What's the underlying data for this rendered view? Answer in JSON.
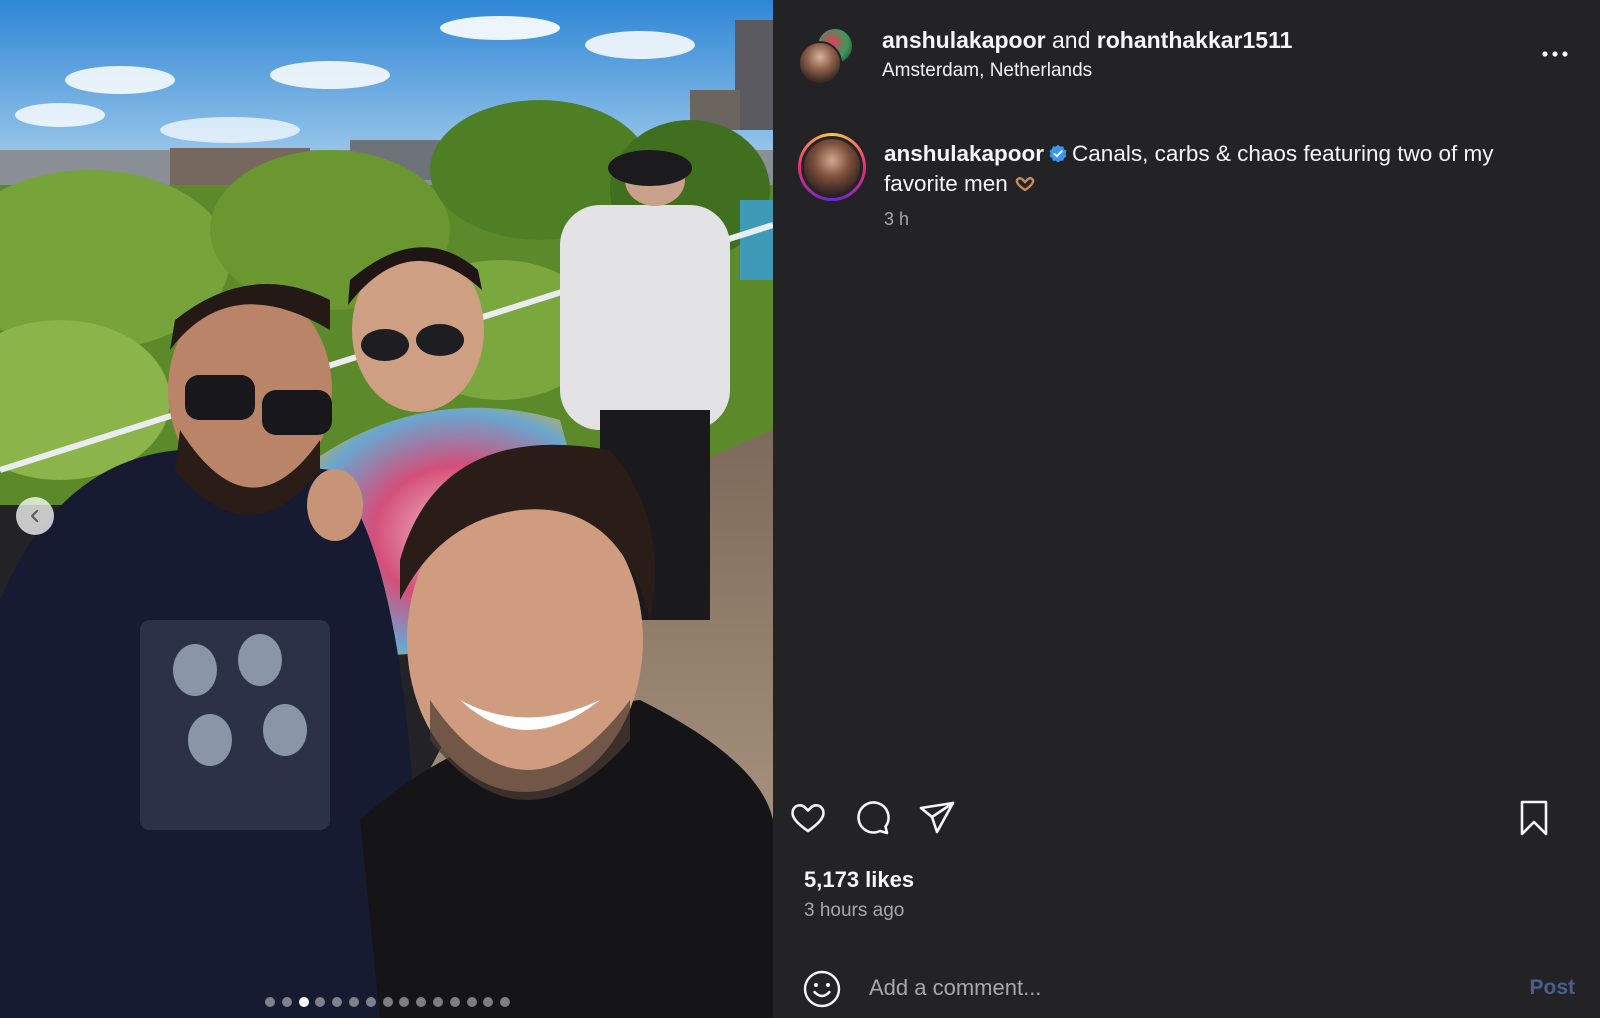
{
  "post": {
    "owner": "anshulakapoor",
    "and_text": "and",
    "coauthor": "rohanthakkar1511",
    "location": "Amsterdam, Netherlands"
  },
  "caption": {
    "username": "anshulakapoor",
    "text": "Canals, carbs & chaos featuring two of my favorite men",
    "time": "3 h"
  },
  "stats": {
    "likes": "5,173 likes",
    "posted": "3 hours ago"
  },
  "comment": {
    "placeholder": "Add a comment...",
    "post_label": "Post"
  },
  "carousel": {
    "slide_count": 15,
    "active_index": 2
  },
  "icons": {
    "more": "more-horizontal-icon",
    "verified": "verified-badge-icon",
    "like": "heart-icon",
    "comment": "comment-icon",
    "share": "send-icon",
    "save": "bookmark-icon",
    "emoji": "smiley-icon",
    "prev": "chevron-left-icon"
  },
  "colors": {
    "background": "#232326",
    "muted_text": "#a8a8a8",
    "verified": "#3897f0",
    "post_disabled": "#49608a"
  }
}
